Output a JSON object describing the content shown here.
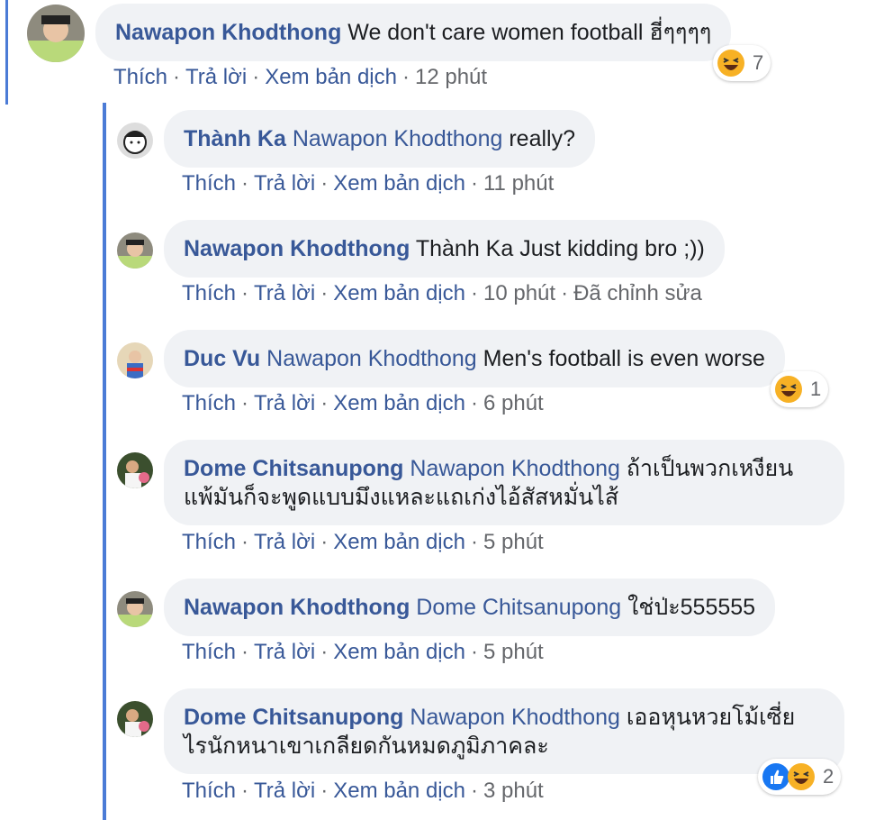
{
  "comments": [
    {
      "author": "Nawapon Khodthong",
      "mention": "",
      "text": "We don't care women football ฮี่ๆๆๆๆ",
      "actions": {
        "like": "Thích",
        "reply": "Trả lời",
        "translate": "Xem bản dịch",
        "time": "12 phút",
        "edited": ""
      },
      "reactions": {
        "icons": [
          "haha-icon"
        ],
        "count": "7"
      }
    },
    {
      "author": "Thành Ka",
      "mention": "Nawapon Khodthong",
      "text": "really?",
      "actions": {
        "like": "Thích",
        "reply": "Trả lời",
        "translate": "Xem bản dịch",
        "time": "11 phút",
        "edited": ""
      }
    },
    {
      "author": "Nawapon Khodthong",
      "mention": "",
      "text": "Thành Ka Just kidding bro ;))",
      "actions": {
        "like": "Thích",
        "reply": "Trả lời",
        "translate": "Xem bản dịch",
        "time": "10 phút",
        "edited": "Đã chỉnh sửa"
      }
    },
    {
      "author": "Duc Vu",
      "mention": "Nawapon Khodthong",
      "text": "Men's football is even worse",
      "actions": {
        "like": "Thích",
        "reply": "Trả lời",
        "translate": "Xem bản dịch",
        "time": "6 phút",
        "edited": ""
      },
      "reactions": {
        "icons": [
          "haha-icon"
        ],
        "count": "1"
      }
    },
    {
      "author": "Dome Chitsanupong",
      "mention": "Nawapon Khodthong",
      "text": "ถ้าเป็นพวกเหงียน",
      "text2": "แพ้มันก็จะพูดแบบมึงแหละแถเก่งไอ้สัสหมั่นไส้",
      "actions": {
        "like": "Thích",
        "reply": "Trả lời",
        "translate": "Xem bản dịch",
        "time": "5 phút",
        "edited": ""
      }
    },
    {
      "author": "Nawapon Khodthong",
      "mention": "Dome Chitsanupong",
      "text": "ใช่ป่ะ555555",
      "actions": {
        "like": "Thích",
        "reply": "Trả lời",
        "translate": "Xem bản dịch",
        "time": "5 phút",
        "edited": ""
      }
    },
    {
      "author": "Dome Chitsanupong",
      "mention": "Nawapon Khodthong",
      "text": "เออหุนหวยโม้เซี่ย",
      "text2": "ไรนักหนาเขาเกลียดกันหมดภูมิภาคละ",
      "actions": {
        "like": "Thích",
        "reply": "Trả lời",
        "translate": "Xem bản dịch",
        "time": "3 phút",
        "edited": ""
      },
      "reactions": {
        "icons": [
          "like-icon",
          "haha-icon"
        ],
        "count": "2"
      }
    }
  ],
  "colors": {
    "name": "#385898",
    "meta": "#65676b",
    "bubble": "#f0f2f5",
    "thread": "#4b7bd6",
    "like": "#1877f2",
    "haha": "#f7b125"
  }
}
